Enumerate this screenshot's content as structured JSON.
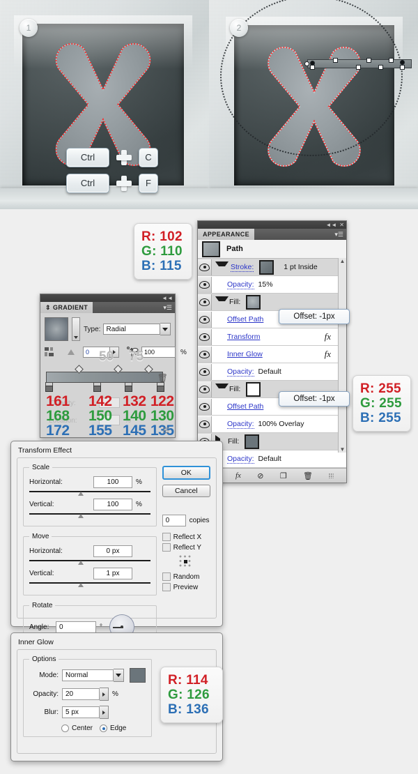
{
  "illustration": {
    "step1": {
      "badge": "1",
      "keys": [
        {
          "modifier": "Ctrl",
          "plus": "+",
          "key": "C"
        },
        {
          "modifier": "Ctrl",
          "plus": "+",
          "key": "F"
        }
      ]
    },
    "step2": {
      "badge": "2"
    }
  },
  "callouts": {
    "stroke_color": {
      "r_label": "R: 102",
      "g_label": "G: 110",
      "b_label": "B: 115"
    },
    "white_fill": {
      "r_label": "R: 255",
      "g_label": "G: 255",
      "b_label": "B: 255"
    }
  },
  "gradient_panel": {
    "tab_title": "GRADIENT",
    "type_label": "Type:",
    "type_value": "Radial",
    "angle_value": "0",
    "aspect_value": "100",
    "percent_unit": "%",
    "ghost_angle": "50",
    "ghost_aspect": "75",
    "ghost_opacity_label": "Opacity:",
    "ghost_location_label": "Location:",
    "ghost_percent": "%",
    "stops": [
      {
        "r": "161",
        "g": "168",
        "b": "172"
      },
      {
        "r": "142",
        "g": "150",
        "b": "155"
      },
      {
        "r": "132",
        "g": "140",
        "b": "145"
      },
      {
        "r": "122",
        "g": "130",
        "b": "135"
      }
    ]
  },
  "appearance_panel": {
    "tab_title": "APPEARANCE",
    "object_name": "Path",
    "rows": [
      {
        "label": "Stroke:",
        "value": "1 pt  Inside",
        "swatch": "#6b757b",
        "kind": "stroke"
      },
      {
        "label": "Opacity:",
        "value": "15%",
        "kind": "opacity"
      },
      {
        "label": "Fill:",
        "swatch": "gradient",
        "kind": "fill"
      },
      {
        "label": "Offset Path",
        "kind": "effect"
      },
      {
        "label": "Transform",
        "kind": "effect",
        "fx": "fx"
      },
      {
        "label": "Inner Glow",
        "kind": "effect",
        "fx": "fx"
      },
      {
        "label": "Opacity:",
        "value": "Default",
        "kind": "opacity"
      },
      {
        "label": "Fill:",
        "swatch": "#ffffff",
        "kind": "fill"
      },
      {
        "label": "Offset Path",
        "kind": "effect"
      },
      {
        "label": "Opacity:",
        "value": "100% Overlay",
        "kind": "opacity"
      },
      {
        "label": "Fill:",
        "swatch": "#6b757b",
        "kind": "fill-collapsed"
      },
      {
        "label": "Opacity:",
        "value": "Default",
        "kind": "opacity"
      }
    ],
    "tooltips": [
      "Offset: -1px",
      "Offset: -1px"
    ]
  },
  "transform_dialog": {
    "title": "Transform Effect",
    "scale_legend": "Scale",
    "scale_horizontal_label": "Horizontal:",
    "scale_horizontal_value": "100",
    "scale_horizontal_unit": "%",
    "scale_vertical_label": "Vertical:",
    "scale_vertical_value": "100",
    "scale_vertical_unit": "%",
    "move_legend": "Move",
    "move_horizontal_label": "Horizontal:",
    "move_horizontal_value": "0 px",
    "move_vertical_label": "Vertical:",
    "move_vertical_value": "1 px",
    "rotate_legend": "Rotate",
    "angle_label": "Angle:",
    "angle_value": "0",
    "angle_unit": "°",
    "ok_label": "OK",
    "cancel_label": "Cancel",
    "copies_value": "0",
    "copies_label": "copies",
    "reflect_x_label": "Reflect X",
    "reflect_y_label": "Reflect Y",
    "random_label": "Random",
    "preview_label": "Preview"
  },
  "inner_glow_dialog": {
    "title": "Inner Glow",
    "options_legend": "Options",
    "mode_label": "Mode:",
    "mode_value": "Normal",
    "opacity_label": "Opacity:",
    "opacity_value": "20",
    "opacity_unit": "%",
    "blur_label": "Blur:",
    "blur_value": "5 px",
    "center_label": "Center",
    "edge_label": "Edge",
    "color": {
      "r_label": "R: 114",
      "g_label": "G: 126",
      "b_label": "B: 136"
    }
  }
}
